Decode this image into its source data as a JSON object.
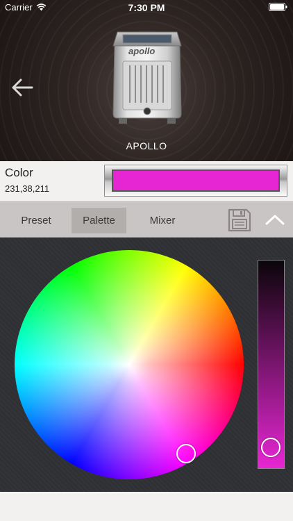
{
  "status_bar": {
    "carrier": "Carrier",
    "time": "7:30 PM"
  },
  "header": {
    "device_name": "APOLLO",
    "device_logo_text": "apollo"
  },
  "color": {
    "label": "Color",
    "value": "231,38,211",
    "swatch_hex": "#e726d3"
  },
  "tabs": [
    {
      "label": "Preset",
      "active": false
    },
    {
      "label": "Palette",
      "active": true
    },
    {
      "label": "Mixer",
      "active": false
    }
  ],
  "icons": {
    "back": "arrow-left-icon",
    "save": "floppy-disk-icon",
    "collapse": "chevron-up-icon",
    "wifi": "wifi-icon",
    "battery": "battery-icon"
  },
  "picker": {
    "brightness_level": 0.9
  }
}
